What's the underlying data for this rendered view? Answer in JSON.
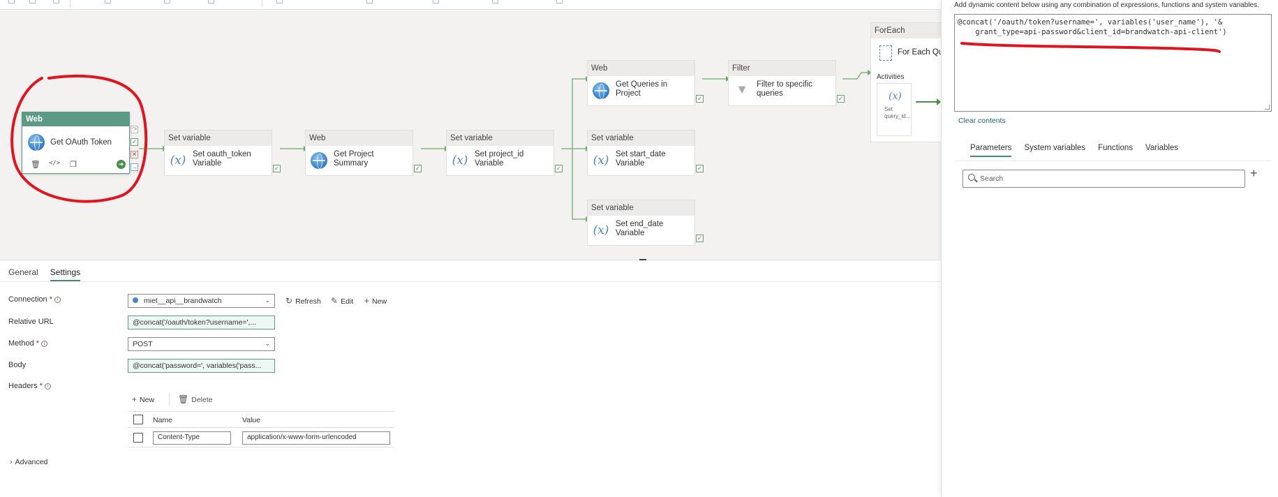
{
  "canvas": {
    "selected_activity": {
      "type": "Web",
      "name": "Get OAuth Token"
    },
    "activities": [
      {
        "id": "set-oauth",
        "type": "Set variable",
        "name": "Set oauth_token Variable",
        "icon": "variable-icon"
      },
      {
        "id": "get-project",
        "type": "Web",
        "name": "Get Project Summary",
        "icon": "globe-icon"
      },
      {
        "id": "set-project",
        "type": "Set variable",
        "name": "Set project_id Variable",
        "icon": "variable-icon"
      },
      {
        "id": "get-queries",
        "type": "Web",
        "name": "Get Queries in Project",
        "icon": "globe-icon"
      },
      {
        "id": "filter",
        "type": "Filter",
        "name": "Filter to specific queries",
        "icon": "funnel-icon"
      },
      {
        "id": "set-start",
        "type": "Set variable",
        "name": "Set start_date Variable",
        "icon": "variable-icon"
      },
      {
        "id": "set-end",
        "type": "Set variable",
        "name": "Set end_date Variable",
        "icon": "variable-icon"
      }
    ],
    "foreach": {
      "type": "ForEach",
      "name": "For Each Qu",
      "activities_label": "Activities",
      "inner_label": "Set query_id..."
    }
  },
  "properties": {
    "tabs": [
      "General",
      "Settings"
    ],
    "active_tab": "Settings",
    "connection": {
      "label": "Connection",
      "value": "miet__api__brandwatch",
      "refresh": "Refresh",
      "edit": "Edit",
      "new": "New"
    },
    "relative_url": {
      "label": "Relative URL",
      "value": "@concat('/oauth/token?username=',..."
    },
    "method": {
      "label": "Method",
      "value": "POST"
    },
    "body": {
      "label": "Body",
      "value": "@concat('password=', variables('pass..."
    },
    "headers": {
      "label": "Headers",
      "new": "New",
      "delete": "Delete",
      "col_name": "Name",
      "col_value": "Value",
      "rows": [
        {
          "name": "Content-Type",
          "value": "application/x-www-form-urlencoded"
        }
      ]
    },
    "advanced": "Advanced"
  },
  "dynamic_panel": {
    "hint": "Add dynamic content below using any combination of expressions, functions and system variables.",
    "code_line1": "@concat('/oauth/token?username=', variables('user_name'), '&",
    "code_line2": "    grant_type=api-password&client_id=brandwatch-api-client')",
    "clear": "Clear contents",
    "tabs": [
      "Parameters",
      "System variables",
      "Functions",
      "Variables"
    ],
    "active_tab": "Parameters",
    "search_placeholder": "Search"
  },
  "colors": {
    "accent": "#3f8b73",
    "annotation": "#e0141e",
    "link": "#6aad6a"
  }
}
